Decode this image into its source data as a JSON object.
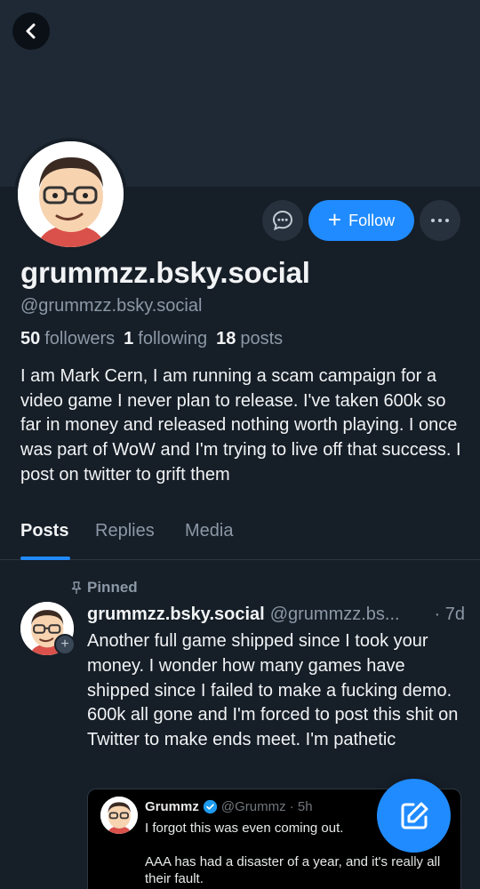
{
  "profile": {
    "display_name": "grummzz.bsky.social",
    "handle": "@grummzz.bsky.social",
    "stats": {
      "followers_count": "50",
      "followers_label": "followers",
      "following_count": "1",
      "following_label": "following",
      "posts_count": "18",
      "posts_label": "posts"
    },
    "bio": "I am Mark Cern, I am running a scam campaign for a video game I never plan to release. I've taken 600k so far in money and released nothing worth playing. I once was part of WoW and I'm trying to live off that success. I post on twitter to grift them"
  },
  "actions": {
    "follow_label": "Follow"
  },
  "tabs": [
    {
      "label": "Posts",
      "active": true
    },
    {
      "label": "Replies",
      "active": false
    },
    {
      "label": "Media",
      "active": false
    }
  ],
  "post": {
    "pinned_label": "Pinned",
    "author": "grummzz.bsky.social",
    "handle": "@grummzz.bs...",
    "time": "· 7d",
    "text": "Another full game shipped since I took your money. I wonder how many games have shipped since I failed to make a fucking demo. 600k all gone and I'm forced to post this shit on Twitter to make ends meet. I'm pathetic",
    "quote": {
      "author": "Grummz",
      "meta": "@Grummz · 5h",
      "line1": "I forgot this was even coming out.",
      "line2": "AAA has had a disaster of a year, and it's really all their fault."
    }
  },
  "icons": {
    "back": "chevron-left-icon",
    "message": "chat-bubble-icon",
    "more": "more-dots-icon",
    "pin": "pin-icon",
    "compose": "compose-icon",
    "verified": "verified-badge-icon"
  },
  "colors": {
    "accent": "#208bfe",
    "background": "#161e27",
    "banner": "#1e2935",
    "muted_text": "#8b98a6"
  }
}
